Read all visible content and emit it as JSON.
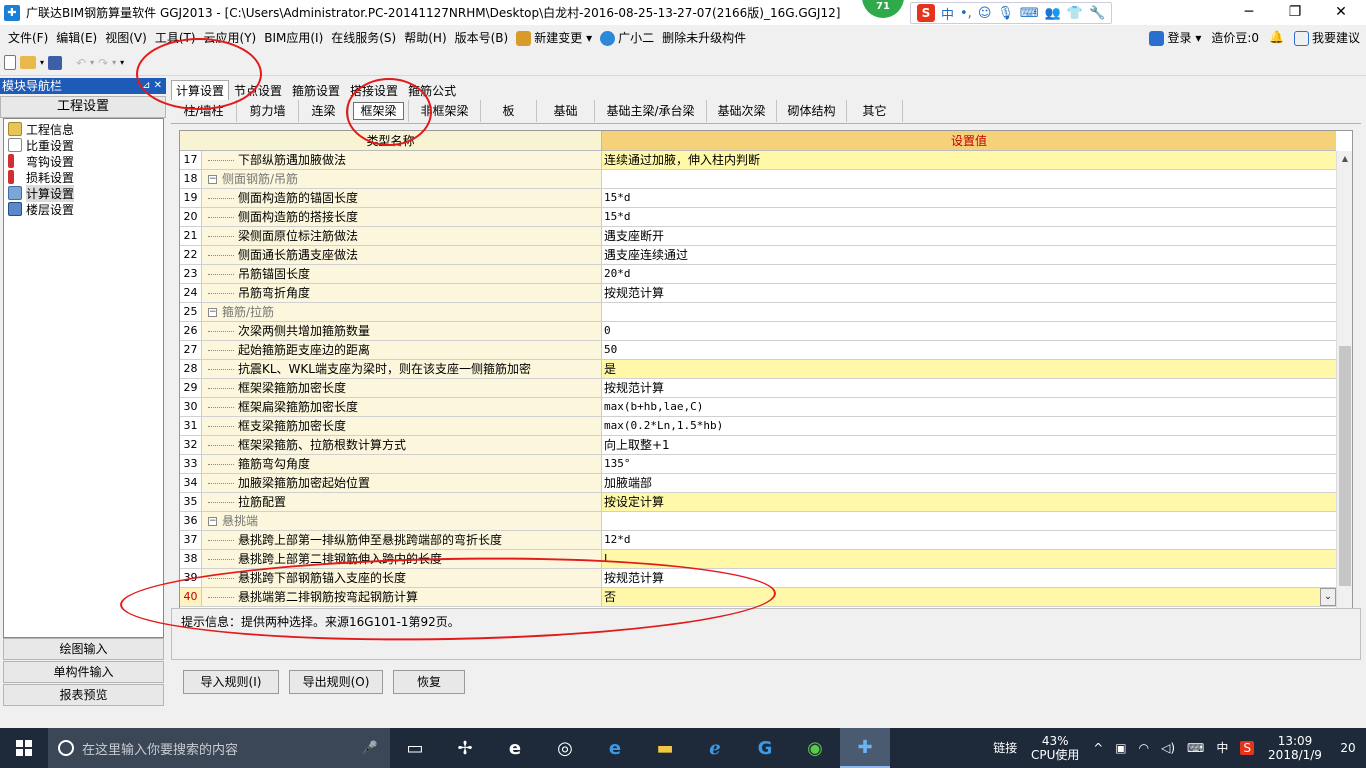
{
  "window": {
    "title": "广联达BIM钢筋算量软件 GGJ2013 - [C:\\Users\\Administrator.PC-20141127NRHM\\Desktop\\白龙村-2016-08-25-13-27-07(2166版)_16G.GGJ12]",
    "badge": "71",
    "ime_label": "中"
  },
  "menu": {
    "items": [
      "文件(F)",
      "编辑(E)",
      "视图(V)",
      "工具(T)",
      "云应用(Y)",
      "BIM应用(I)",
      "在线服务(S)",
      "帮助(H)",
      "版本号(B)",
      "新建变更",
      "广小二",
      "删除未升级构件"
    ],
    "right": [
      "登录",
      "造价豆:0",
      "我要建议"
    ]
  },
  "nav": {
    "title": "模块导航栏",
    "section": "工程设置",
    "tree": [
      "工程信息",
      "比重设置",
      "弯钩设置",
      "损耗设置",
      "计算设置",
      "楼层设置"
    ],
    "bottom": [
      "绘图输入",
      "单构件输入",
      "报表预览"
    ]
  },
  "tabs": {
    "top": [
      "计算设置",
      "节点设置",
      "箍筋设置",
      "搭接设置",
      "箍筋公式"
    ],
    "sub": [
      "柱/墙柱",
      "剪力墙",
      "连梁",
      "框架梁",
      "非框架梁",
      "板",
      "基础",
      "基础主梁/承台梁",
      "基础次梁",
      "砌体结构",
      "其它"
    ]
  },
  "grid": {
    "headers": {
      "name": "类型名称",
      "value": "设置值"
    },
    "rows": [
      {
        "n": "17",
        "name": "下部纵筋遇加腋做法",
        "value": "连续通过加腋，伸入柱内判断"
      },
      {
        "n": "18",
        "name": "侧面钢筋/吊筋",
        "value": ""
      },
      {
        "n": "19",
        "name": "侧面构造筋的锚固长度",
        "value": "15*d"
      },
      {
        "n": "20",
        "name": "侧面构造筋的搭接长度",
        "value": "15*d"
      },
      {
        "n": "21",
        "name": "梁侧面原位标注筋做法",
        "value": "遇支座断开"
      },
      {
        "n": "22",
        "name": "侧面通长筋遇支座做法",
        "value": "遇支座连续通过"
      },
      {
        "n": "23",
        "name": "吊筋锚固长度",
        "value": "20*d"
      },
      {
        "n": "24",
        "name": "吊筋弯折角度",
        "value": "按规范计算"
      },
      {
        "n": "25",
        "name": "箍筋/拉筋",
        "value": ""
      },
      {
        "n": "26",
        "name": "次梁两侧共增加箍筋数量",
        "value": "0"
      },
      {
        "n": "27",
        "name": "起始箍筋距支座边的距离",
        "value": "50"
      },
      {
        "n": "28",
        "name": "抗震KL、WKL端支座为梁时，则在该支座一侧箍筋加密",
        "value": "是"
      },
      {
        "n": "29",
        "name": "框架梁箍筋加密长度",
        "value": "按规范计算"
      },
      {
        "n": "30",
        "name": "框架扁梁箍筋加密长度",
        "value": "max(b+hb,lae,C)"
      },
      {
        "n": "31",
        "name": "框支梁箍筋加密长度",
        "value": "max(0.2*Ln,1.5*hb)"
      },
      {
        "n": "32",
        "name": "框架梁箍筋、拉筋根数计算方式",
        "value": "向上取整+1"
      },
      {
        "n": "33",
        "name": "箍筋弯勾角度",
        "value": "135°"
      },
      {
        "n": "34",
        "name": "加腋梁箍筋加密起始位置",
        "value": "加腋端部"
      },
      {
        "n": "35",
        "name": "拉筋配置",
        "value": "按设定计算"
      },
      {
        "n": "36",
        "name": "悬挑端",
        "value": ""
      },
      {
        "n": "37",
        "name": "悬挑跨上部第一排纵筋伸至悬挑跨端部的弯折长度",
        "value": "12*d"
      },
      {
        "n": "38",
        "name": "悬挑跨上部第二排钢筋伸入跨内的长度",
        "value": "L"
      },
      {
        "n": "39",
        "name": "悬挑跨下部钢筋锚入支座的长度",
        "value": "按规范计算"
      },
      {
        "n": "40",
        "name": "悬挑端第二排钢筋按弯起钢筋计算",
        "value": "否"
      }
    ]
  },
  "hint": "提示信息：提供两种选择。来源16G101-1第92页。",
  "buttons": [
    "导入规则(I)",
    "导出规则(O)",
    "恢复"
  ],
  "taskbar": {
    "search_placeholder": "在这里输入你要搜索的内容",
    "link": "链接",
    "cpu_pct": "43%",
    "cpu_label": "CPU使用",
    "ime": "中",
    "time": "13:09",
    "date": "2018/1/9",
    "notif": "20"
  }
}
